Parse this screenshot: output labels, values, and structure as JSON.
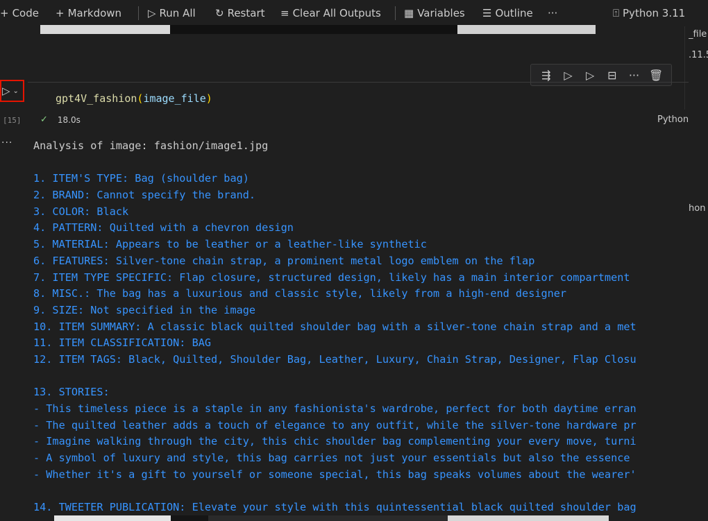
{
  "toolbar": {
    "code_label": "Code",
    "markdown_label": "Markdown",
    "run_all_label": "Run All",
    "restart_label": "Restart",
    "clear_outputs_label": "Clear All Outputs",
    "variables_label": "Variables",
    "outline_label": "Outline",
    "more_label": "···",
    "kernel_label": "Python 3.11"
  },
  "right_panel": {
    "line1": "_file",
    "line2": ".11.5",
    "line3": "hon"
  },
  "cell": {
    "code": {
      "function": "gpt4V_fashion",
      "open": "(",
      "arg": "image_file",
      "close": ")"
    },
    "exec_count": "[15]",
    "duration": "18.0s",
    "language": "Python",
    "output_more": "···"
  },
  "output_lines": [
    {
      "text": "Analysis of image: fashion/image1.jpg",
      "plain": true
    },
    {
      "text": ""
    },
    {
      "text": "1. ITEM'S TYPE: Bag (shoulder bag)"
    },
    {
      "text": "2. BRAND: Cannot specify the brand."
    },
    {
      "text": "3. COLOR: Black"
    },
    {
      "text": "4. PATTERN: Quilted with a chevron design"
    },
    {
      "text": "5. MATERIAL: Appears to be leather or a leather-like synthetic"
    },
    {
      "text": "6. FEATURES: Silver-tone chain strap, a prominent metal logo emblem on the flap"
    },
    {
      "text": "7. ITEM TYPE SPECIFIC: Flap closure, structured design, likely has a main interior compartment"
    },
    {
      "text": "8. MISC.: The bag has a luxurious and classic style, likely from a high-end designer"
    },
    {
      "text": "9. SIZE: Not specified in the image"
    },
    {
      "text": "10. ITEM SUMMARY: A classic black quilted shoulder bag with a silver-tone chain strap and a met"
    },
    {
      "text": "11. ITEM CLASSIFICATION: BAG"
    },
    {
      "text": "12. ITEM TAGS: Black, Quilted, Shoulder Bag, Leather, Luxury, Chain Strap, Designer, Flap Closu"
    },
    {
      "text": ""
    },
    {
      "text": "13. STORIES:"
    },
    {
      "text": "- This timeless piece is a staple in any fashionista's wardrobe, perfect for both daytime erran"
    },
    {
      "text": "- The quilted leather adds a touch of elegance to any outfit, while the silver-tone hardware pr"
    },
    {
      "text": "- Imagine walking through the city, this chic shoulder bag complementing your every move, turni"
    },
    {
      "text": "- A symbol of luxury and style, this bag carries not just your essentials but also the essence"
    },
    {
      "text": "- Whether it's a gift to yourself or someone special, this bag speaks volumes about the wearer'"
    },
    {
      "text": ""
    },
    {
      "text": "14. TWEETER PUBLICATION: Elevate your style with this quintessential black quilted shoulder bag"
    }
  ],
  "icons": {
    "add": "+",
    "run_all": "▷",
    "restart": "↻",
    "clear": "≡",
    "variables": "▦",
    "outline": "☰",
    "kernel": "⍐",
    "play": "▷",
    "chevron": "⌄",
    "check": "✓",
    "ct_run_by_line": "⇶",
    "ct_run_above": "▷",
    "ct_run_below": "▷",
    "ct_split": "⊟",
    "ct_more": "···",
    "ct_delete": "🗑"
  },
  "colors": {
    "background": "#1f1f1f",
    "output_text": "#3794ff",
    "run_highlight": "#e51400",
    "success": "#89d185"
  }
}
